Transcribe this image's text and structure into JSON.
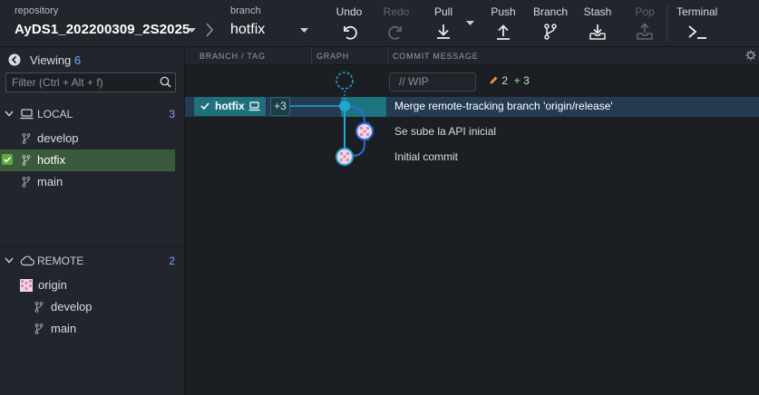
{
  "toolbar": {
    "repository_label": "repository",
    "repository_name": "AyDS1_202200309_2S2025",
    "branch_label": "branch",
    "branch_name": "hotfix",
    "buttons": {
      "undo": "Undo",
      "redo": "Redo",
      "pull": "Pull",
      "push": "Push",
      "branch": "Branch",
      "stash": "Stash",
      "pop": "Pop",
      "terminal": "Terminal"
    }
  },
  "sidebar": {
    "viewing_label": "Viewing",
    "viewing_count": "6",
    "filter_placeholder": "Filter (Ctrl + Alt + f)",
    "local": {
      "label": "LOCAL",
      "count": "3",
      "branches": [
        "develop",
        "hotfix",
        "main"
      ],
      "active_branch": "hotfix"
    },
    "remote": {
      "label": "REMOTE",
      "count": "2",
      "remote_name": "origin",
      "branches": [
        "develop",
        "main"
      ]
    }
  },
  "graph": {
    "columns": {
      "branch_tag": "BRANCH / TAG",
      "graph": "GRAPH",
      "commit_message": "COMMIT MESSAGE"
    },
    "wip": {
      "placeholder": "// WIP",
      "modified_count": "2",
      "added_count": "3"
    },
    "branch_tag": {
      "name": "hotfix",
      "extra": "+3"
    },
    "commits": [
      {
        "message": "Merge remote-tracking branch 'origin/release'",
        "selected": true
      },
      {
        "message": "Se sube la API inicial",
        "selected": false
      },
      {
        "message": "Initial commit",
        "selected": false
      }
    ]
  },
  "colors": {
    "accent_teal": "#1f6f7d",
    "selection": "#243b52",
    "active_branch_bg": "#3a5a3b",
    "check_green": "#5fa93f",
    "lane_cyan": "#22a7d0",
    "lane_blue": "#2a6fd6",
    "count_blue": "#7aa2ff"
  }
}
